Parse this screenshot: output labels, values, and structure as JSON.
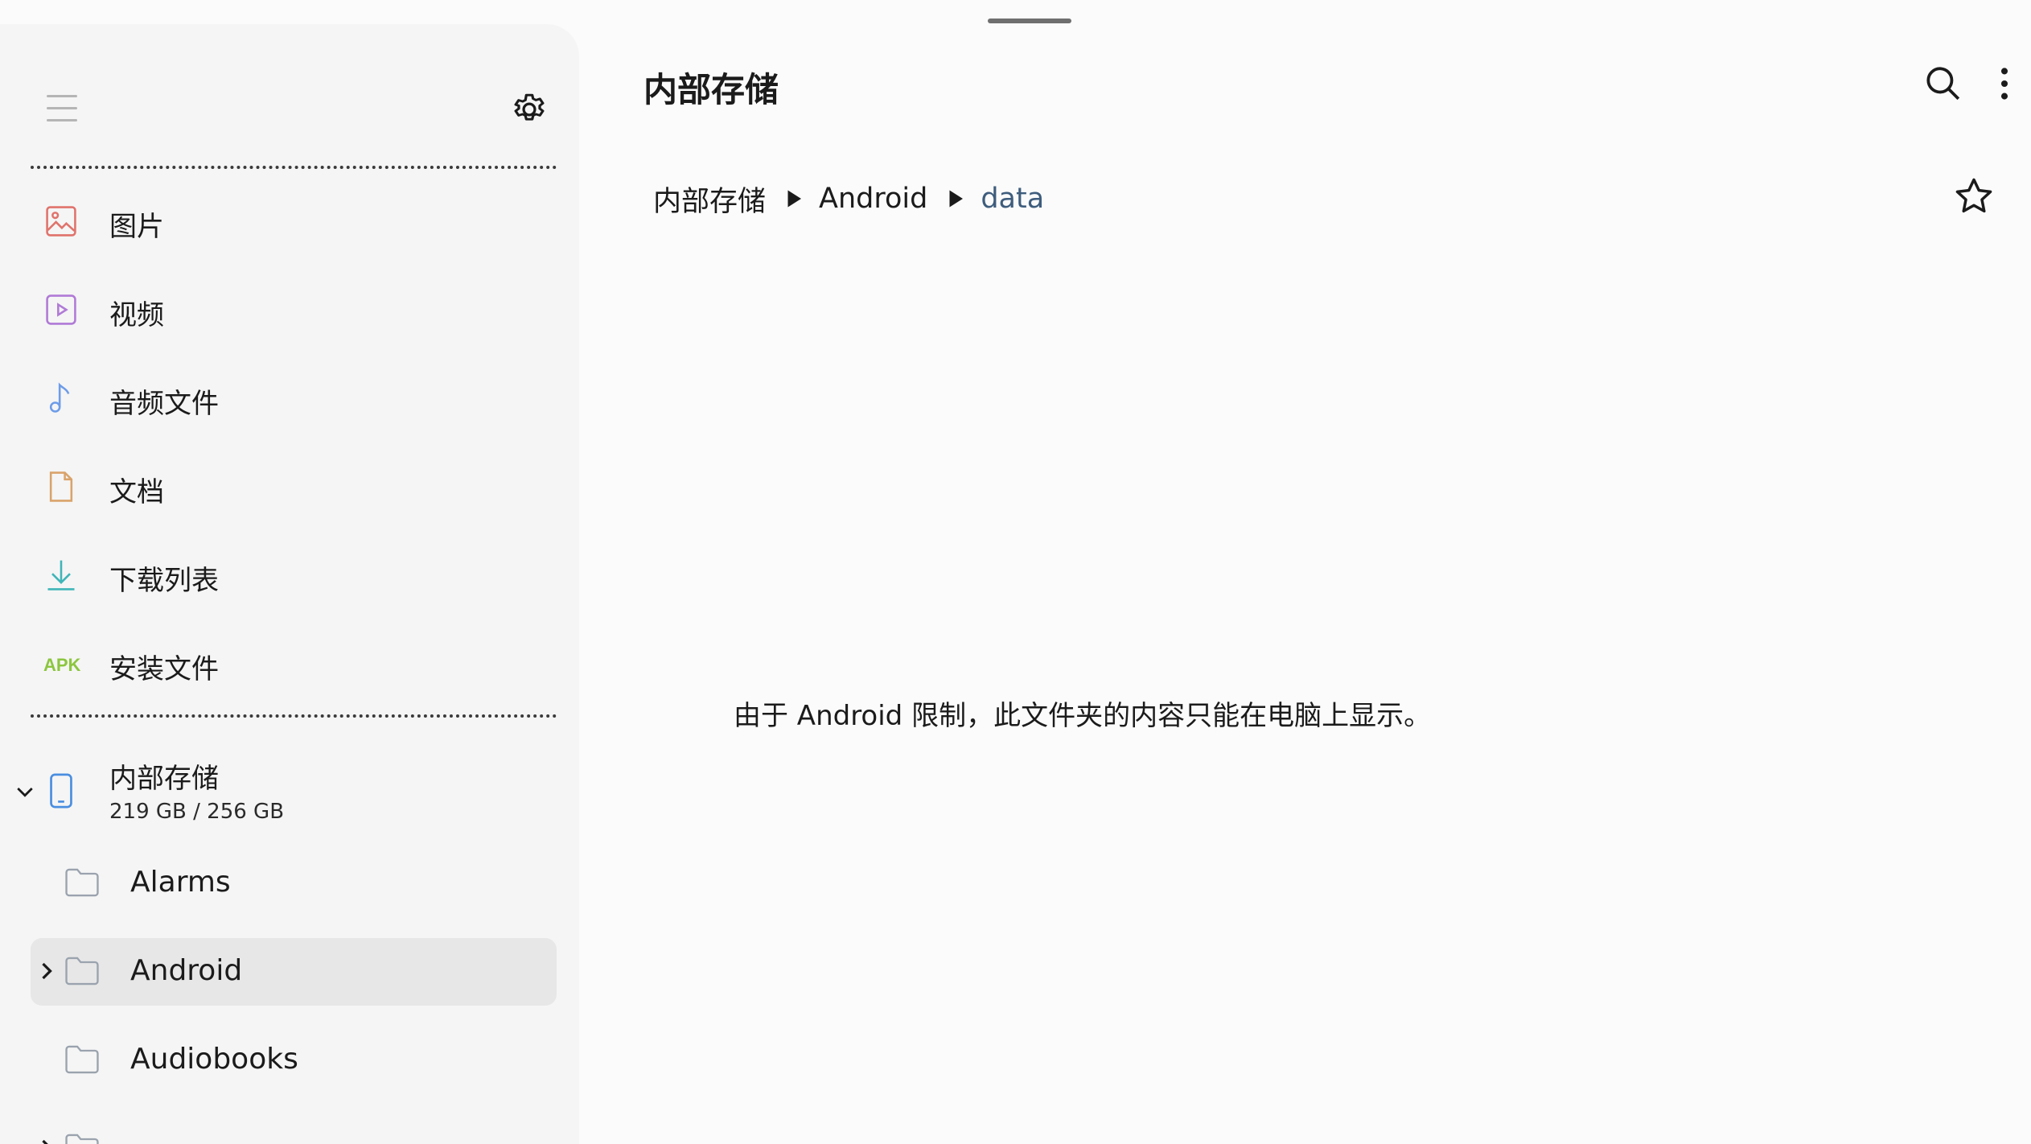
{
  "header": {
    "title": "内部存储",
    "search_icon": "search-icon",
    "more_icon": "more-vert-icon"
  },
  "sidebar": {
    "categories": [
      {
        "label": "图片",
        "icon": "image-icon",
        "color": "#e0736c"
      },
      {
        "label": "视频",
        "icon": "video-icon",
        "color": "#b07ad6"
      },
      {
        "label": "音频文件",
        "icon": "music-note-icon",
        "color": "#6d9ce8"
      },
      {
        "label": "文档",
        "icon": "document-icon",
        "color": "#d9a36b"
      },
      {
        "label": "下载列表",
        "icon": "download-icon",
        "color": "#3fb5b8"
      },
      {
        "label": "安装文件",
        "icon": "apk-icon",
        "color": "#8cc63f",
        "badge": "APK"
      }
    ],
    "storage": {
      "name": "内部存储",
      "size": "219 GB / 256 GB",
      "color": "#4a8ee0"
    },
    "folders": [
      {
        "name": "Alarms",
        "expandable": false,
        "selected": false
      },
      {
        "name": "Android",
        "expandable": true,
        "selected": true
      },
      {
        "name": "Audiobooks",
        "expandable": false,
        "selected": false
      },
      {
        "name": "",
        "expandable": true,
        "selected": false
      }
    ]
  },
  "breadcrumb": {
    "items": [
      "内部存储",
      "Android",
      "data"
    ]
  },
  "notice": "由于 Android 限制，此文件夹的内容只能在电脑上显示。"
}
